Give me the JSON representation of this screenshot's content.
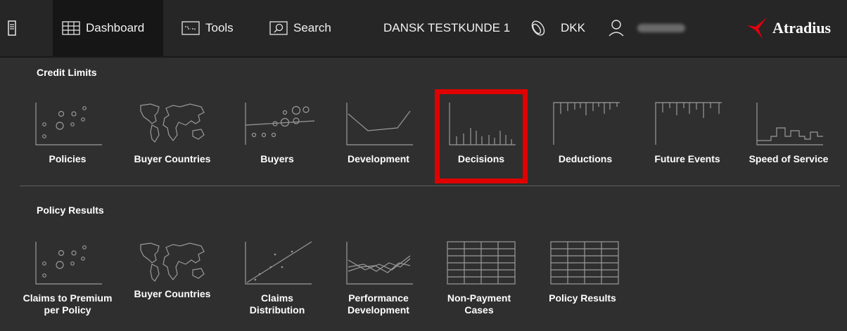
{
  "header": {
    "nav": [
      {
        "label": "Dashboard",
        "icon": "grid-icon",
        "active": true
      },
      {
        "label": "Tools",
        "icon": "tools-icon"
      },
      {
        "label": "Search",
        "icon": "search-icon"
      }
    ],
    "customer": "DANSK TESTKUNDE 1",
    "currency": "DKK",
    "logo_text": "Atradius",
    "logo_color": "#e3000b"
  },
  "credit_limits": {
    "title": "Credit Limits",
    "tiles": [
      {
        "label": "Policies",
        "icon": "bubble-chart-icon"
      },
      {
        "label": "Buyer Countries",
        "icon": "world-map-icon"
      },
      {
        "label": "Buyers",
        "icon": "network-icon"
      },
      {
        "label": "Development",
        "icon": "line-chart-icon"
      },
      {
        "label": "Decisions",
        "icon": "bar-chart-icon",
        "highlighted": true
      },
      {
        "label": "Deductions",
        "icon": "inverted-bar-chart-icon"
      },
      {
        "label": "Future Events",
        "icon": "timeline-bar-icon"
      },
      {
        "label": "Speed of Service",
        "icon": "step-chart-icon"
      }
    ]
  },
  "policy_results": {
    "title": "Policy Results",
    "tiles": [
      {
        "line1": "Claims to Premium",
        "line2": "per Policy",
        "icon": "bubble-chart-icon"
      },
      {
        "line1": "Buyer Countries",
        "line2": "",
        "icon": "world-map-icon"
      },
      {
        "line1": "Claims",
        "line2": "Distribution",
        "icon": "scatter-trend-icon"
      },
      {
        "line1": "Performance",
        "line2": "Development",
        "icon": "multi-line-chart-icon"
      },
      {
        "line1": "Non-Payment",
        "line2": "Cases",
        "icon": "table-icon"
      },
      {
        "line1": "Policy Results",
        "line2": "",
        "icon": "table-icon"
      }
    ]
  },
  "highlight_color": "#e00000"
}
